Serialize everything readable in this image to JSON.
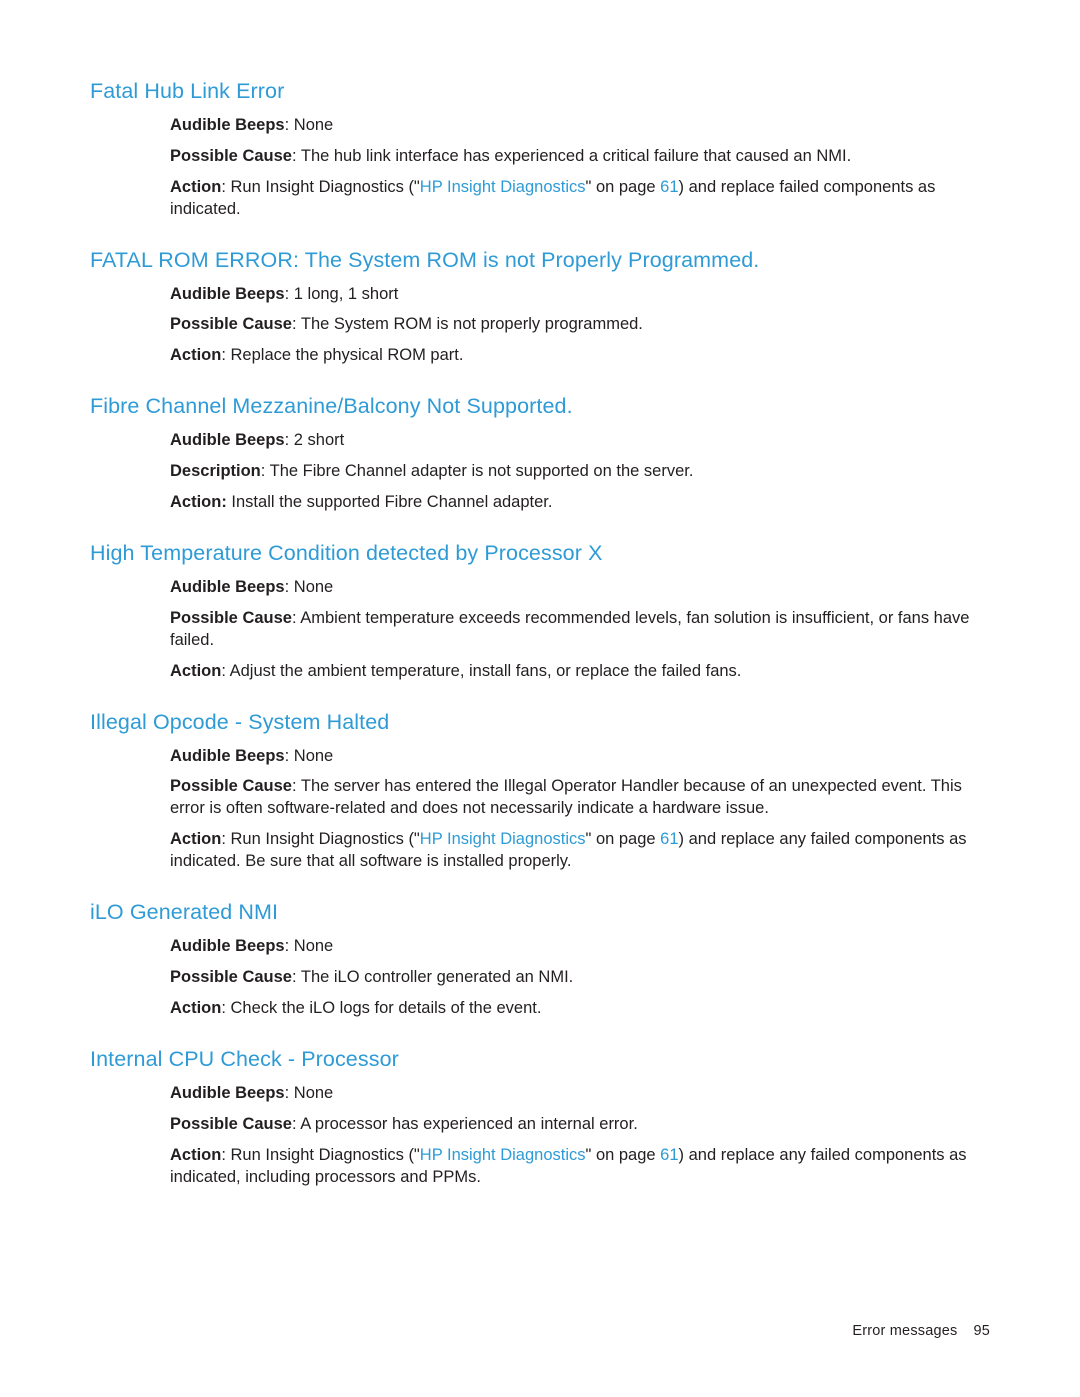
{
  "document": {
    "footer_label": "Error messages",
    "page_number": "95"
  },
  "link_text": {
    "hp_insight_diagnostics": "HP Insight Diagnostics",
    "page_61": "61"
  },
  "sections": [
    {
      "title": "Fatal Hub Link Error",
      "title_indent": 0,
      "paragraphs": [
        {
          "lead": "Audible Beeps",
          "sep": ": ",
          "rest": "None",
          "parts": null
        },
        {
          "lead": "Possible Cause",
          "sep": ": ",
          "rest": "The hub link interface has experienced a critical failure that caused an NMI.",
          "parts": null
        },
        {
          "lead": "Action",
          "sep": ": ",
          "rest": null,
          "parts": [
            {
              "type": "text",
              "value": "Run Insight Diagnostics (\""
            },
            {
              "type": "link",
              "value": "HP Insight Diagnostics"
            },
            {
              "type": "text",
              "value": "\" on page "
            },
            {
              "type": "link",
              "value": "61"
            },
            {
              "type": "text",
              "value": ") and replace failed components as indicated."
            }
          ]
        }
      ]
    },
    {
      "title": "FATAL ROM ERROR: The System ROM is not Properly Programmed.",
      "title_indent": 0,
      "paragraphs": [
        {
          "lead": "Audible Beeps",
          "sep": ": ",
          "rest": "1 long, 1 short",
          "parts": null
        },
        {
          "lead": "Possible Cause",
          "sep": ": ",
          "rest": "The System ROM is not properly programmed.",
          "parts": null
        },
        {
          "lead": "Action",
          "sep": ": ",
          "rest": "Replace the physical ROM part.",
          "parts": null
        }
      ]
    },
    {
      "title": "Fibre Channel Mezzanine/Balcony Not Supported.",
      "title_indent": 0,
      "paragraphs": [
        {
          "lead": "Audible Beeps",
          "sep": ": ",
          "rest": "2 short",
          "parts": null
        },
        {
          "lead": "Description",
          "sep": ": ",
          "rest": "The Fibre Channel adapter is not supported on the server.",
          "parts": null
        },
        {
          "lead": "Action:",
          "sep": " ",
          "rest": "Install the supported Fibre Channel adapter.",
          "parts": null
        }
      ]
    },
    {
      "title": "High Temperature Condition detected by Processor X",
      "title_indent": 0,
      "paragraphs": [
        {
          "lead": "Audible Beeps",
          "sep": ": ",
          "rest": "None",
          "parts": null
        },
        {
          "lead": "Possible Cause",
          "sep": ": ",
          "rest": "Ambient temperature exceeds recommended levels, fan solution is insufficient, or fans have failed.",
          "parts": null
        },
        {
          "lead": "Action",
          "sep": ": ",
          "rest": "Adjust the ambient temperature, install fans, or replace the failed fans.",
          "parts": null
        }
      ]
    },
    {
      "title": "Illegal Opcode - System Halted",
      "title_indent": 0,
      "paragraphs": [
        {
          "lead": "Audible Beeps",
          "sep": ": ",
          "rest": "None",
          "parts": null
        },
        {
          "lead": "Possible Cause",
          "sep": ": ",
          "rest": "The server has entered the Illegal Operator Handler because of an unexpected event. This error is often software-related and does not necessarily indicate a hardware issue.",
          "parts": null
        },
        {
          "lead": "Action",
          "sep": ": ",
          "rest": null,
          "parts": [
            {
              "type": "text",
              "value": "Run Insight Diagnostics (\""
            },
            {
              "type": "link",
              "value": "HP Insight Diagnostics"
            },
            {
              "type": "text",
              "value": "\" on page "
            },
            {
              "type": "link",
              "value": "61"
            },
            {
              "type": "text",
              "value": ") and replace any failed components as indicated. Be sure that all software is installed properly."
            }
          ]
        }
      ]
    },
    {
      "title": "iLO Generated NMI",
      "title_indent": 0,
      "paragraphs": [
        {
          "lead": "Audible Beeps",
          "sep": ": ",
          "rest": "None",
          "parts": null
        },
        {
          "lead": "Possible Cause",
          "sep": ": ",
          "rest": "The iLO controller generated an NMI.",
          "parts": null
        },
        {
          "lead": "Action",
          "sep": ": ",
          "rest": "Check the iLO logs for details of the event.",
          "parts": null
        }
      ]
    },
    {
      "title": "Internal CPU Check - Processor",
      "title_indent": 0,
      "paragraphs": [
        {
          "lead": "Audible Beeps",
          "sep": ": ",
          "rest": "None",
          "parts": null
        },
        {
          "lead": "Possible Cause",
          "sep": ": ",
          "rest": "A processor has experienced an internal error.",
          "parts": null
        },
        {
          "lead": "Action",
          "sep": ": ",
          "rest": null,
          "parts": [
            {
              "type": "text",
              "value": "Run Insight Diagnostics (\""
            },
            {
              "type": "link",
              "value": "HP Insight Diagnostics"
            },
            {
              "type": "text",
              "value": "\" on page "
            },
            {
              "type": "link",
              "value": "61"
            },
            {
              "type": "text",
              "value": ") and replace any failed components as indicated, including processors and PPMs."
            }
          ]
        }
      ]
    }
  ],
  "colors": {
    "heading": "#2e9bd6",
    "link": "#2e9bd6",
    "body": "#231f20"
  }
}
